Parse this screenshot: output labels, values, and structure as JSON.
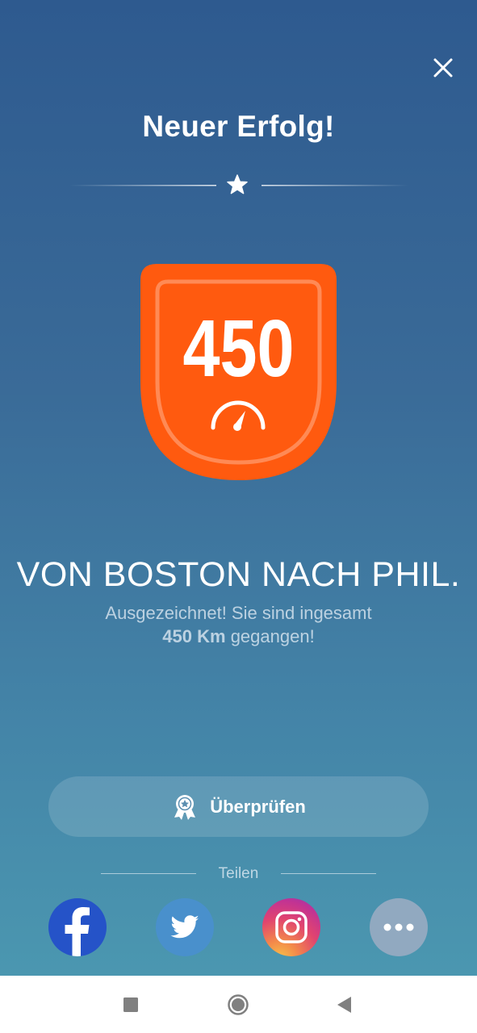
{
  "header": {
    "title": "Neuer Erfolg!",
    "close_icon": "close-icon",
    "divider_icon": "star-icon"
  },
  "badge": {
    "value": "450",
    "icon": "speedometer-icon",
    "color": "#ff5a0f"
  },
  "achievement": {
    "headline": "VON BOSTON NACH PHIL.",
    "line1": "Ausgezeichnet! Sie sind ingesamt",
    "line2_bold": "450 Km",
    "line2_rest": " gegangen!"
  },
  "review_button": {
    "label": "Überprüfen",
    "icon": "award-ribbon-icon"
  },
  "share": {
    "label": "Teilen",
    "buttons": [
      {
        "name": "facebook",
        "icon": "facebook-icon",
        "color": "#2553c8"
      },
      {
        "name": "twitter",
        "icon": "twitter-icon",
        "color": "#4990cc"
      },
      {
        "name": "instagram",
        "icon": "instagram-icon",
        "color": "#e1446f"
      },
      {
        "name": "more",
        "icon": "more-dots-icon",
        "color": "#91a9c0"
      }
    ]
  },
  "navigation_bar": {
    "buttons": [
      "recent-apps-icon",
      "home-icon",
      "back-icon"
    ]
  }
}
